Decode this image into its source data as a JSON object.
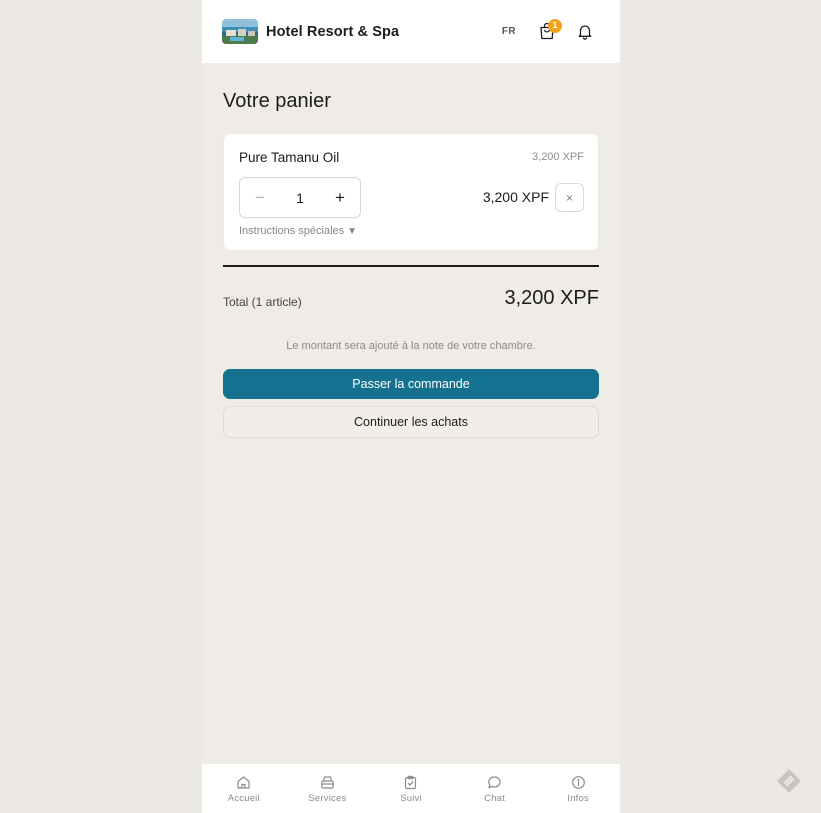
{
  "header": {
    "brand": "Hotel Resort & Spa",
    "lang": "FR",
    "cart_count": "1",
    "icons": [
      "logo-image",
      "shopping-bag-icon",
      "bell-icon"
    ]
  },
  "cart": {
    "title": "Votre panier",
    "items": [
      {
        "name": "Pure Tamanu Oil",
        "unit_price": "3,200 XPF",
        "quantity": "1",
        "line_total": "3,200 XPF",
        "minus_label": "−",
        "plus_label": "+",
        "remove_label": "×",
        "instructions_label": "Instructions spéciales",
        "instructions_arrow": "▼"
      }
    ],
    "total_label": "Total (1 article)",
    "total_value": "3,200 XPF",
    "note": "Le montant sera ajouté à la note de votre chambre.",
    "checkout_label": "Passer la commande",
    "continue_label": "Continuer les achats"
  },
  "nav": {
    "items": [
      {
        "label": "Accueil",
        "icon": "home-icon"
      },
      {
        "label": "Services",
        "icon": "services-icon"
      },
      {
        "label": "Suivi",
        "icon": "clipboard-icon"
      },
      {
        "label": "Chat",
        "icon": "chat-icon"
      },
      {
        "label": "Infos",
        "icon": "info-icon"
      }
    ]
  },
  "colors": {
    "primary": "#157190",
    "badge": "#f2a31b",
    "background": "#efece7"
  }
}
